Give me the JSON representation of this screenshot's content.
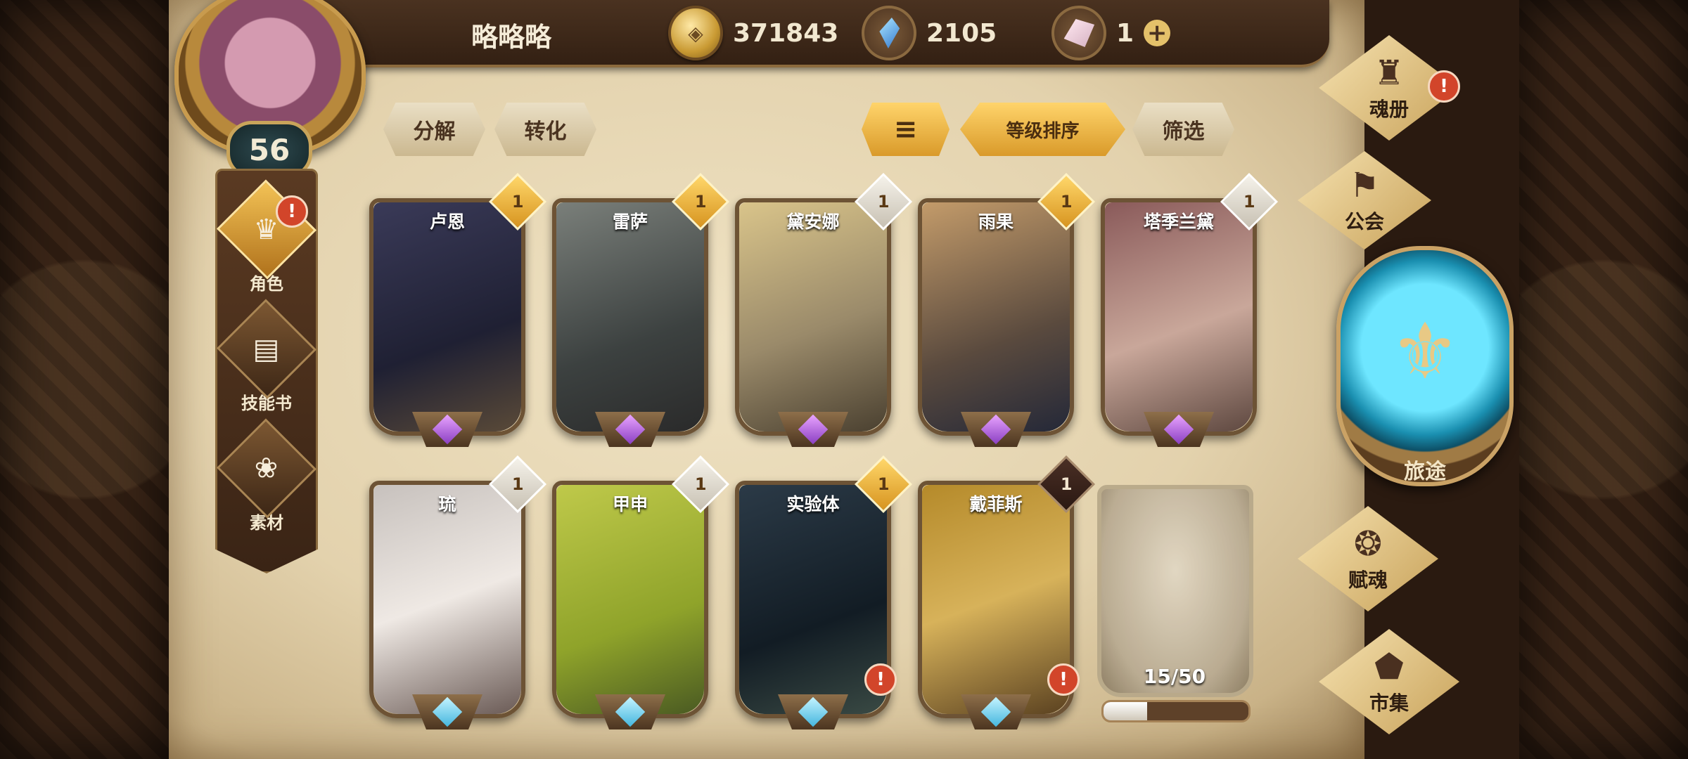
{
  "player": {
    "name": "略略略",
    "level": "56"
  },
  "currencies": {
    "gold": "371843",
    "blue_crystal": "2105",
    "pink_crystal": "1"
  },
  "left_menu": [
    {
      "label": "角色",
      "icon": "character-icon",
      "active": true,
      "alert": true
    },
    {
      "label": "技能书",
      "icon": "skillbook-icon",
      "active": false,
      "alert": false
    },
    {
      "label": "素材",
      "icon": "material-icon",
      "active": false,
      "alert": false
    }
  ],
  "actions": {
    "decompose": "分解",
    "convert": "转化",
    "sort_icon": "sort-icon",
    "sort_level": "等级排序",
    "filter": "筛选"
  },
  "cards": [
    {
      "name": "卢恩",
      "stars": "1",
      "rarity": "gold",
      "foot": "purple"
    },
    {
      "name": "雷萨",
      "stars": "1",
      "rarity": "gold",
      "foot": "purple"
    },
    {
      "name": "黛安娜",
      "stars": "1",
      "rarity": "silver",
      "foot": "purple"
    },
    {
      "name": "雨果",
      "stars": "1",
      "rarity": "gold",
      "foot": "purple"
    },
    {
      "name": "塔季兰黛",
      "stars": "1",
      "rarity": "silver",
      "foot": "purple"
    },
    {
      "name": "琉",
      "stars": "1",
      "rarity": "silver",
      "foot": "blue"
    },
    {
      "name": "甲申",
      "stars": "1",
      "rarity": "silver",
      "foot": "blue"
    },
    {
      "name": "实验体",
      "stars": "1",
      "rarity": "gold",
      "foot": "blue",
      "alert": true
    },
    {
      "name": "戴菲斯",
      "stars": "1",
      "rarity": "dark",
      "foot": "blue",
      "alert": true
    }
  ],
  "roster": {
    "count": "15/50",
    "fill_fraction": 0.3
  },
  "right_nav": {
    "soul_book": "魂册",
    "guild": "公会",
    "journey": "旅途",
    "endow": "赋魂",
    "market": "市集"
  },
  "colors": {
    "alert": "#d2452a",
    "gold_accent": "#e0a530",
    "parchment": "#e6d6b2"
  }
}
